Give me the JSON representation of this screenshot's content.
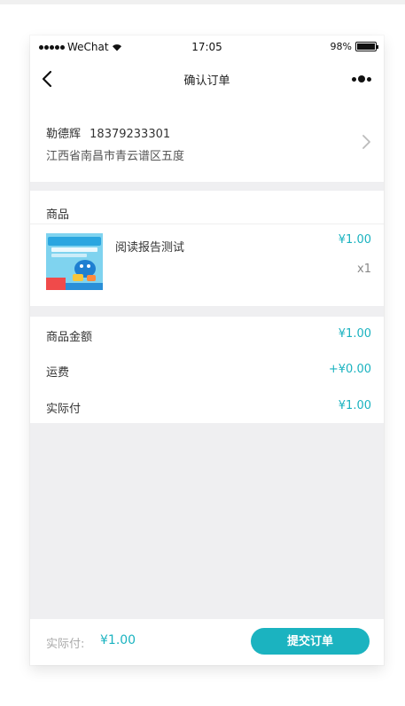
{
  "status_bar": {
    "carrier": "WeChat",
    "time": "17:05",
    "battery": "98%"
  },
  "nav": {
    "title": "确认订单"
  },
  "address": {
    "name": "勒德辉",
    "phone": "18379233301",
    "address": "江西省南昌市青云谱区五度"
  },
  "goods": {
    "header": "商品",
    "items": [
      {
        "name": "阅读报告测试",
        "price": "¥1.00",
        "quantity": "x1"
      }
    ]
  },
  "summary": {
    "rows": [
      {
        "label": "商品金额",
        "value": "¥1.00"
      },
      {
        "label": "运费",
        "value": "+¥0.00"
      },
      {
        "label": "实际付",
        "value": "¥1.00"
      }
    ]
  },
  "footer": {
    "pay_label": "实际付:",
    "pay_amount": "¥1.00",
    "submit_label": "提交订单"
  },
  "colors": {
    "accent": "#1bb3c0",
    "background": "#efeff1"
  },
  "icons": {
    "back": "chevron-left-icon",
    "more": "more-dots-icon",
    "address_arrow": "chevron-right-icon"
  }
}
